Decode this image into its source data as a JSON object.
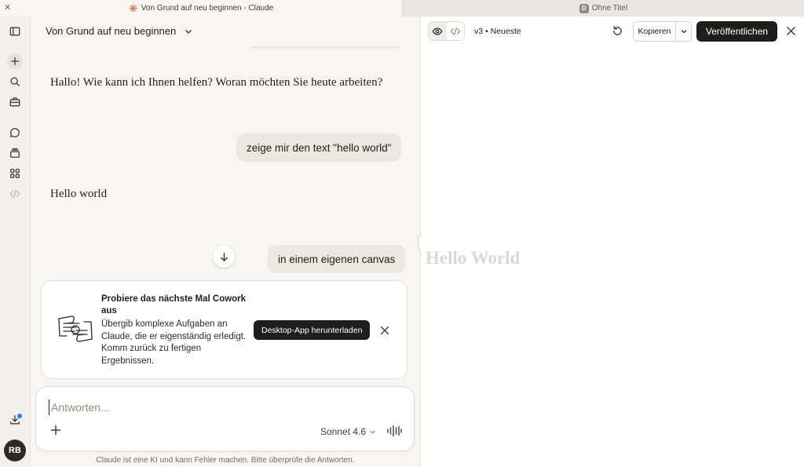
{
  "tabs": [
    {
      "title": "Von Grund auf neu beginnen - Claude"
    },
    {
      "title": "Ohne Titel",
      "icon_letter": "D"
    }
  ],
  "conversation": {
    "title": "Von Grund auf neu beginnen",
    "messages": [
      {
        "role": "assistant",
        "text": "Hallo! Wie kann ich Ihnen helfen? Woran möchten Sie heute arbeiten?"
      },
      {
        "role": "user",
        "text": "zeige mir den text \"hello world\""
      },
      {
        "role": "assistant",
        "text": "Hello world"
      },
      {
        "role": "user",
        "text": "in einem eigenen canvas"
      }
    ]
  },
  "promo": {
    "title": "Probiere das nächste Mal Cowork aus",
    "text": "Übergib komplexe Aufgaben an Claude, die er eigenständig erledigt. Komm zurück zu fertigen Ergebnissen.",
    "button": "Desktop-App herunterladen"
  },
  "composer": {
    "placeholder": "Antworten...",
    "model": "Sonnet 4.6"
  },
  "disclaimer": "Claude ist eine KI und kann Fehler machen. Bitte überprüfe die Antworten.",
  "user": {
    "initials": "RB"
  },
  "artifact": {
    "version": "v3",
    "version_label": "Neueste",
    "copy_label": "Kopieren",
    "publish_label": "Veröffentlichen",
    "content": "Hello World"
  },
  "colors": {
    "accent_dark": "#1f1e1d",
    "notification": "#2f7cf6",
    "claude_orange": "#d97757"
  }
}
